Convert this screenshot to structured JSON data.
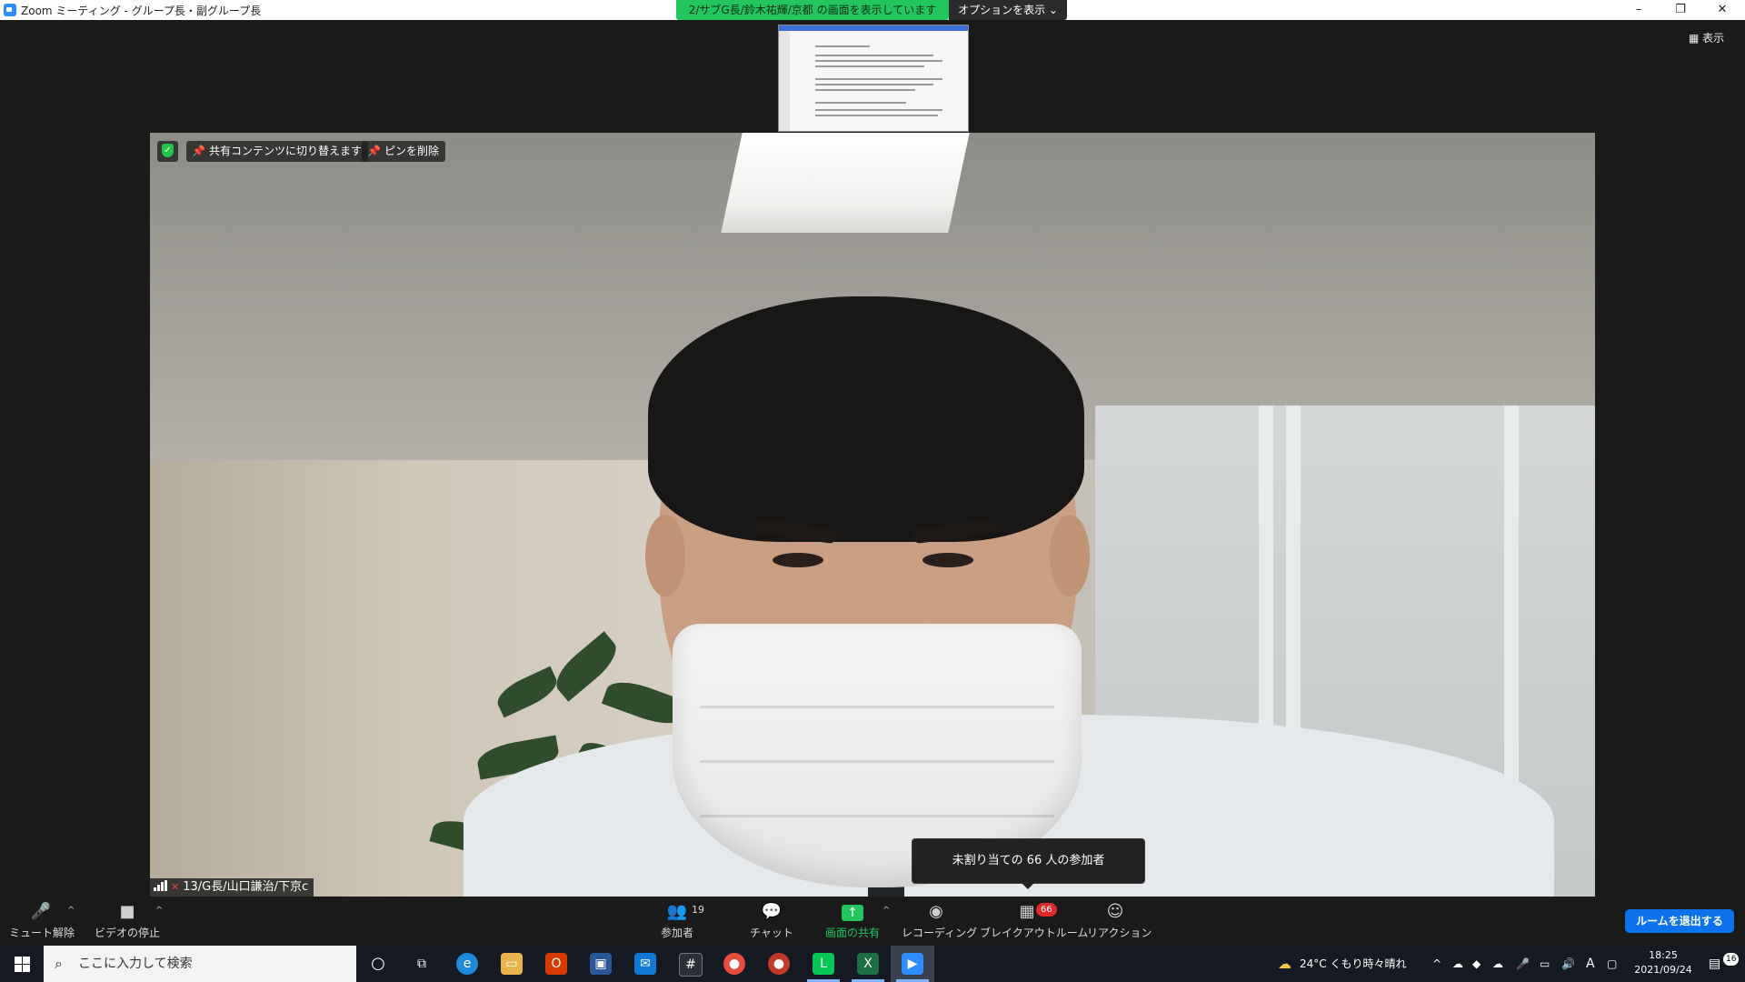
{
  "window": {
    "title": "Zoom ミーティング - グループ長・副グループ長",
    "minimize": "–",
    "restore": "❐",
    "close": "✕"
  },
  "share_banner": {
    "text": "2/サブG長/鈴木祐輝/京都 の画面を表示しています",
    "options_label": "オプションを表示 ⌄"
  },
  "view_button": {
    "label": "表示",
    "icon": "grid-icon"
  },
  "video_overlay": {
    "switch_label": "共有コンテンツに切り替えます",
    "unpin_label": "ピンを削除",
    "participant_name": "13/G長/山口謙治/下京c"
  },
  "tooltip": {
    "text": "未割り当ての 66 人の参加者"
  },
  "toolbar": {
    "mute_label": "ミュート解除",
    "video_label": "ビデオの停止",
    "participants_label": "参加者",
    "participants_count": "19",
    "chat_label": "チャット",
    "share_label": "画面の共有",
    "record_label": "レコーディング",
    "breakout_label": "ブレイクアウトルーム",
    "breakout_badge": "66",
    "reactions_label": "リアクション",
    "leave_label": "ルームを退出する"
  },
  "taskbar": {
    "search_placeholder": "ここに入力して検索",
    "weather": "24°C くもり時々晴れ",
    "ime": "A",
    "time": "18:25",
    "date": "2021/09/24",
    "notifications": "16"
  },
  "colors": {
    "share_green": "#22c55e",
    "leave_blue": "#0e72ed",
    "badge_red": "#e02828",
    "toolbar_bg": "#1a1a1a"
  }
}
